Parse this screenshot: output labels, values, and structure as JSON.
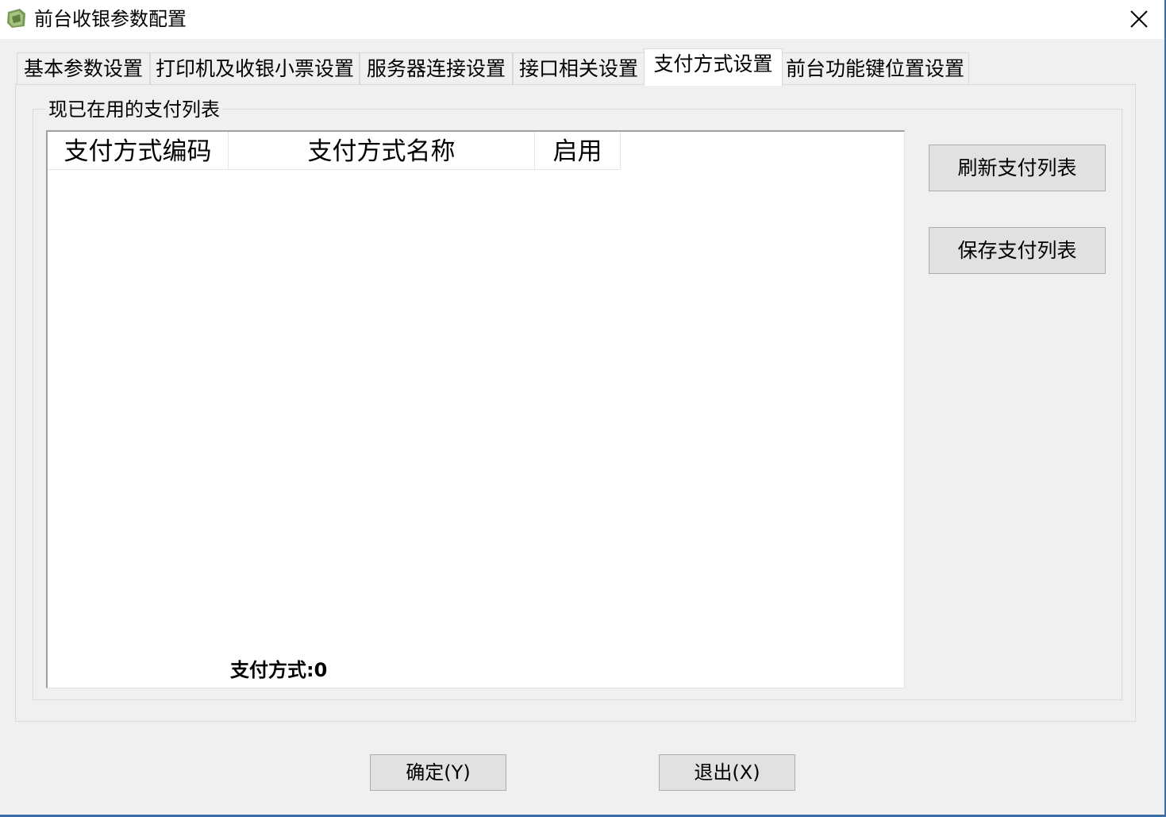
{
  "window": {
    "title": "前台收银参数配置",
    "app_icon": "app-icon",
    "close_icon": "close-icon"
  },
  "tabs": [
    {
      "label": "基本参数设置",
      "active": false
    },
    {
      "label": "打印机及收银小票设置",
      "active": false
    },
    {
      "label": "服务器连接设置",
      "active": false
    },
    {
      "label": "接口相关设置",
      "active": false
    },
    {
      "label": "支付方式设置",
      "active": true
    },
    {
      "label": "前台功能键位置设置",
      "active": false
    }
  ],
  "payment_group": {
    "label": "现已在用的支付列表",
    "columns": [
      "支付方式编码",
      "支付方式名称",
      "启用"
    ],
    "rows": [],
    "status": "支付方式:0"
  },
  "side_buttons": {
    "refresh": "刷新支付列表",
    "save": "保存支付列表"
  },
  "bottom_buttons": {
    "ok": "确定(Y)",
    "exit": "退出(X)"
  },
  "colors": {
    "window_bg": "#f0f0f0",
    "border_accent": "#3b6ea5",
    "button_bg": "#e1e1e1"
  }
}
